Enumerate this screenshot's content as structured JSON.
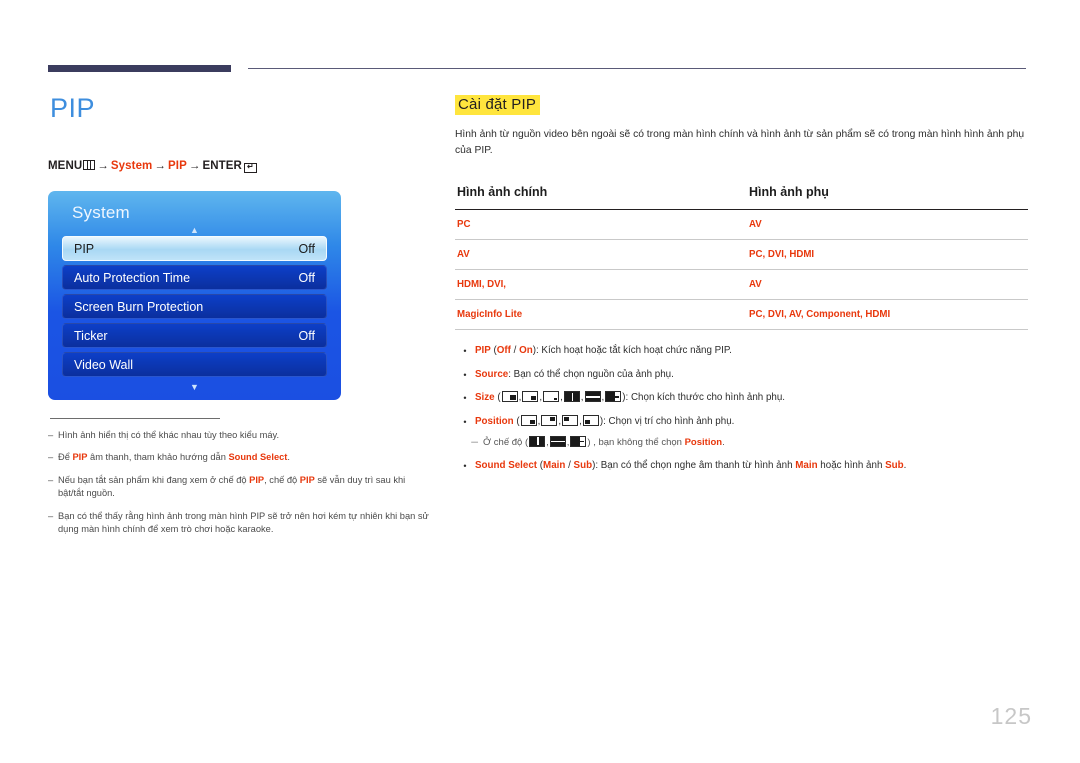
{
  "document": {
    "page_number": "125"
  },
  "left": {
    "title": "PIP",
    "menu_path": {
      "menu_label": "MENU",
      "menu_icon": "menu-grid-icon",
      "arrow": "→",
      "step1": "System",
      "step2": "PIP",
      "enter_label": "ENTER",
      "enter_icon": "enter-key-icon"
    },
    "osd": {
      "title": "System",
      "scroll_up_icon": "▲",
      "scroll_down_icon": "▼",
      "items": [
        {
          "label": "PIP",
          "value": "Off",
          "selected": true
        },
        {
          "label": "Auto Protection Time",
          "value": "Off",
          "selected": false
        },
        {
          "label": "Screen Burn Protection",
          "value": "",
          "selected": false
        },
        {
          "label": "Ticker",
          "value": "Off",
          "selected": false
        },
        {
          "label": "Video Wall",
          "value": "",
          "selected": false
        }
      ]
    },
    "notes": [
      {
        "dash": "–",
        "text": "Hình ảnh hiển thị có thể khác nhau tùy theo kiểu máy."
      },
      {
        "dash": "–",
        "text": "Để PIP âm thanh, tham khảo hướng dẫn Sound Select."
      },
      {
        "dash": "–",
        "text": "Nếu bạn tắt sản phẩm khi đang xem ở chế độ PIP, chế độ PIP sẽ vẫn duy trì sau khi bật/tắt nguồn."
      },
      {
        "dash": "–",
        "text": "Bạn có thể thấy rằng hình ảnh trong màn hình PIP sẽ trở nên hơi kém tự nhiên khi bạn sử dụng màn hình chính để xem trò chơi hoặc karaoke."
      }
    ]
  },
  "right": {
    "section_title": "Cài đặt PIP",
    "intro": "Hình ảnh từ nguồn video bên ngoài sẽ có trong màn hình chính và hình ảnh từ sản phẩm sẽ có trong màn hình hình ảnh phụ của PIP.",
    "table": {
      "headers": [
        "Hình ảnh chính",
        "Hình ảnh phụ"
      ],
      "rows": [
        {
          "main": "PC",
          "sub": "AV"
        },
        {
          "main": "AV",
          "sub": "PC, DVI, HDMI"
        },
        {
          "main": "HDMI, DVI,",
          "sub": "AV"
        },
        {
          "main": "MagicInfo Lite",
          "sub": "PC, DVI, AV, Component, HDMI"
        }
      ]
    },
    "bullets": {
      "pip": {
        "bullet": "•",
        "term": "PIP",
        "paren_open": " (",
        "opt1": "Off",
        "slash": " / ",
        "opt2": "On",
        "paren_close": ")",
        "desc": ": Kích hoạt hoặc tắt kích hoạt chức năng PIP."
      },
      "source": {
        "bullet": "•",
        "term": "Source",
        "desc": ": Bạn có thể chọn nguồn của ảnh phụ."
      },
      "size": {
        "bullet": "•",
        "term": "Size",
        "paren_open": " (",
        "paren_close": ")",
        "desc": ": Chọn kích thước cho hình ảnh phụ.",
        "icons": [
          "pip-large-icon",
          "pip-medium-icon",
          "pip-small-icon",
          "pip-split-vertical-icon",
          "pip-split-horizontal-icon",
          "pip-split-wide-icon"
        ]
      },
      "position": {
        "bullet": "•",
        "term": "Position",
        "paren_open": " (",
        "paren_close": ")",
        "desc": ": Chọn vị trí cho hình ảnh phụ.",
        "icons": [
          "pos-bottom-right-icon",
          "pos-top-right-icon",
          "pos-top-left-icon",
          "pos-bottom-left-icon"
        ]
      },
      "position_note": {
        "dash": "─",
        "pre": "Ở chế độ (",
        "post": ") , bạn không thể chọn ",
        "term": "Position",
        "end": ".",
        "icons": [
          "pip-split-vertical-icon",
          "pip-split-horizontal-icon",
          "pip-split-wide-icon"
        ]
      },
      "sound_select": {
        "bullet": "•",
        "term": "Sound Select",
        "paren_open": " (",
        "opt1": "Main",
        "slash": " / ",
        "opt2": "Sub",
        "paren_close": ")",
        "desc1": ": Bạn có thể chọn nghe âm thanh từ hình ảnh ",
        "term2": "Main",
        "desc2": " hoặc hình ảnh ",
        "term3": "Sub",
        "end": "."
      }
    }
  },
  "colors": {
    "accent_red": "#e8380d",
    "title_blue": "#3e8ede",
    "highlight_yellow": "#ffe53d",
    "osd_blue": "#1b4fe2",
    "rule_dark": "#3b3c5e"
  }
}
